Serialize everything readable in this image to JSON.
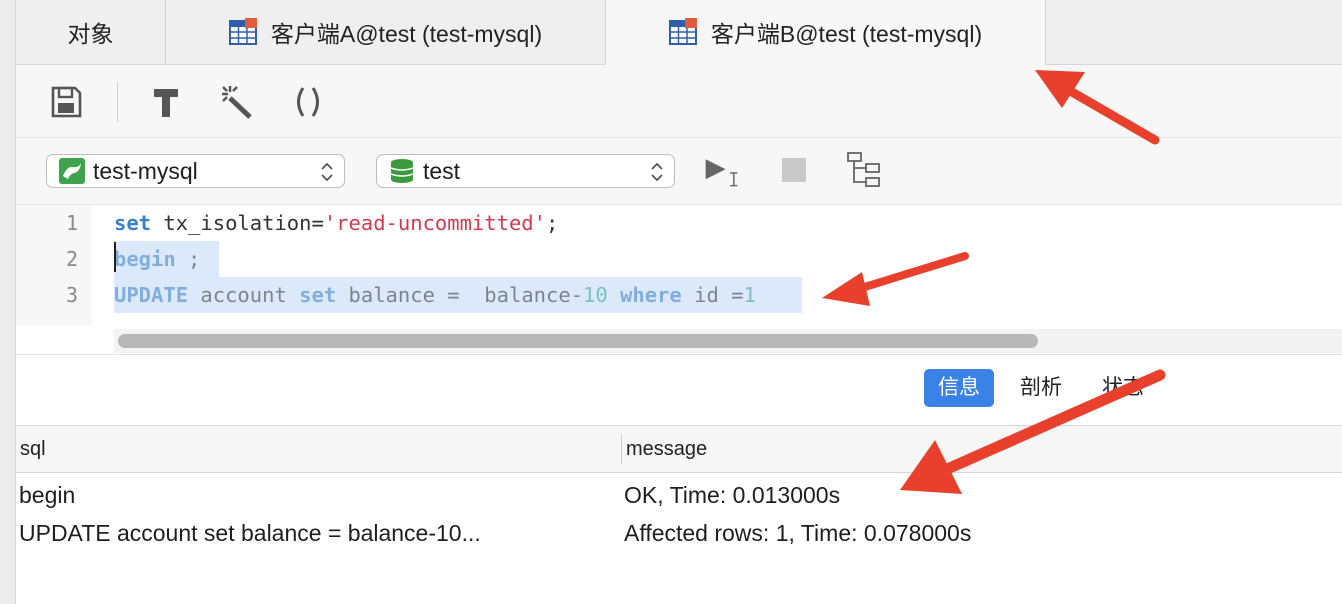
{
  "tabs": [
    {
      "label": "对象"
    },
    {
      "label": "客户端A@test (test-mysql)"
    },
    {
      "label": "客户端B@test (test-mysql)"
    }
  ],
  "toolbar": {
    "icons": [
      "save-icon",
      "hammer-icon",
      "magic-wand-icon",
      "parentheses-icon"
    ]
  },
  "connection_select": {
    "value": "test-mysql"
  },
  "database_select": {
    "value": "test"
  },
  "editor": {
    "lines": [
      {
        "number": "1",
        "kw": "set",
        "rest": " tx_isolation=",
        "string": "'read-uncommitted'",
        "tail": ";"
      },
      {
        "number": "2",
        "kw": "begin",
        "rest": " ;"
      },
      {
        "number": "3",
        "kw1": "UPDATE",
        "t1": " account ",
        "kw2": "set",
        "t2": " balance =  balance-",
        "num1": "10",
        "sp": " ",
        "kw3": "where",
        "t3": " id =",
        "num2": "1"
      }
    ]
  },
  "result_tabs": [
    "信息",
    "剖析",
    "状态"
  ],
  "result_tab_active": "信息",
  "results": {
    "columns": [
      "sql",
      "message"
    ],
    "rows": [
      {
        "sql": "begin",
        "message": "OK, Time: 0.013000s"
      },
      {
        "sql": "UPDATE account set balance =  balance-10...",
        "message": "Affected rows: 1, Time: 0.078000s"
      }
    ]
  },
  "colors": {
    "accent": "#3b82e8",
    "arrow": "#e8402c",
    "keyword": "#3a7fc9",
    "string": "#d23a4f",
    "number": "#2aa198",
    "selection": "#dbe9fb"
  }
}
